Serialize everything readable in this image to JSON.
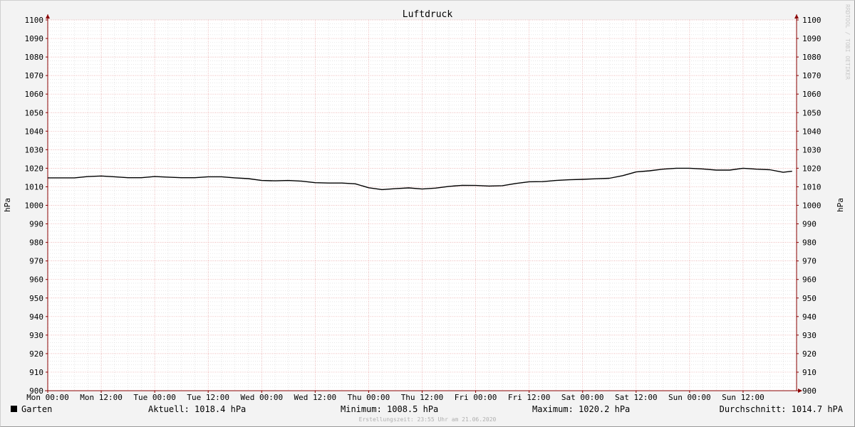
{
  "chart_data": {
    "type": "line",
    "title": "Luftdruck",
    "ylabel": "hPa",
    "ylabel_right": "hPa",
    "ylim": [
      900,
      1100
    ],
    "y_ticks": [
      900,
      910,
      920,
      930,
      940,
      950,
      960,
      970,
      980,
      990,
      1000,
      1010,
      1020,
      1030,
      1040,
      1050,
      1060,
      1070,
      1080,
      1090,
      1100
    ],
    "y_tick_labels": [
      "900",
      "910",
      "920",
      "930",
      "940",
      "950",
      "960",
      "970",
      "980",
      "990",
      "1000",
      "1010",
      "1020",
      "1030",
      "1040",
      "1050",
      "1060",
      "1070",
      "1080",
      "1090",
      "1100"
    ],
    "x_tick_labels": [
      "Mon 00:00",
      "Mon 12:00",
      "Tue 00:00",
      "Tue 12:00",
      "Wed 00:00",
      "Wed 12:00",
      "Thu 00:00",
      "Thu 12:00",
      "Fri 00:00",
      "Fri 12:00",
      "Sat 00:00",
      "Sat 12:00",
      "Sun 00:00",
      "Sun 12:00"
    ],
    "x_unit": "hours since Mon 00:00",
    "xlim": [
      0,
      168
    ],
    "grid": true,
    "colors": {
      "line": "#000000",
      "major_grid": "#e8a0a0",
      "minor_grid": "#d8d8d8",
      "axis": "#8b0000",
      "plot_bg": "#ffffff"
    },
    "series": [
      {
        "name": "Garten",
        "x": [
          0,
          6,
          9,
          12,
          15,
          18,
          21,
          24,
          27,
          30,
          33,
          36,
          39,
          42,
          45,
          48,
          51,
          54,
          57,
          60,
          63,
          66,
          69,
          72,
          75,
          78,
          81,
          84,
          87,
          90,
          93,
          96,
          99,
          102,
          105,
          108,
          111,
          114,
          117,
          120,
          123,
          126,
          129,
          132,
          135,
          138,
          141,
          144,
          147,
          150,
          153,
          156,
          159,
          162,
          165,
          167
        ],
        "y": [
          1014.8,
          1014.8,
          1015.5,
          1015.8,
          1015.4,
          1014.9,
          1014.9,
          1015.5,
          1015.2,
          1014.9,
          1014.9,
          1015.4,
          1015.4,
          1014.8,
          1014.4,
          1013.4,
          1013.2,
          1013.4,
          1013.0,
          1012.2,
          1012.0,
          1012.0,
          1011.6,
          1009.5,
          1008.5,
          1009.0,
          1009.4,
          1008.8,
          1009.3,
          1010.2,
          1010.8,
          1010.7,
          1010.4,
          1010.6,
          1011.8,
          1012.7,
          1012.8,
          1013.4,
          1013.8,
          1014.0,
          1014.3,
          1014.6,
          1016.0,
          1018.0,
          1018.6,
          1019.5,
          1020.0,
          1020.0,
          1019.6,
          1019.0,
          1019.0,
          1020.0,
          1019.5,
          1019.2,
          1017.8,
          1018.4
        ]
      }
    ]
  },
  "legend": {
    "series_name": "Garten",
    "current": "Aktuell: 1018.4 hPa",
    "minimum": "Minimum: 1008.5 hPa",
    "maximum": "Maximum: 1020.2 hPa",
    "average": "Durchschnitt: 1014.7 hPA"
  },
  "footer": "Erstellungszeit: 23:55 Uhr am 21.06.2020",
  "watermark": "RRDTOOL / TOBI OETIKER"
}
